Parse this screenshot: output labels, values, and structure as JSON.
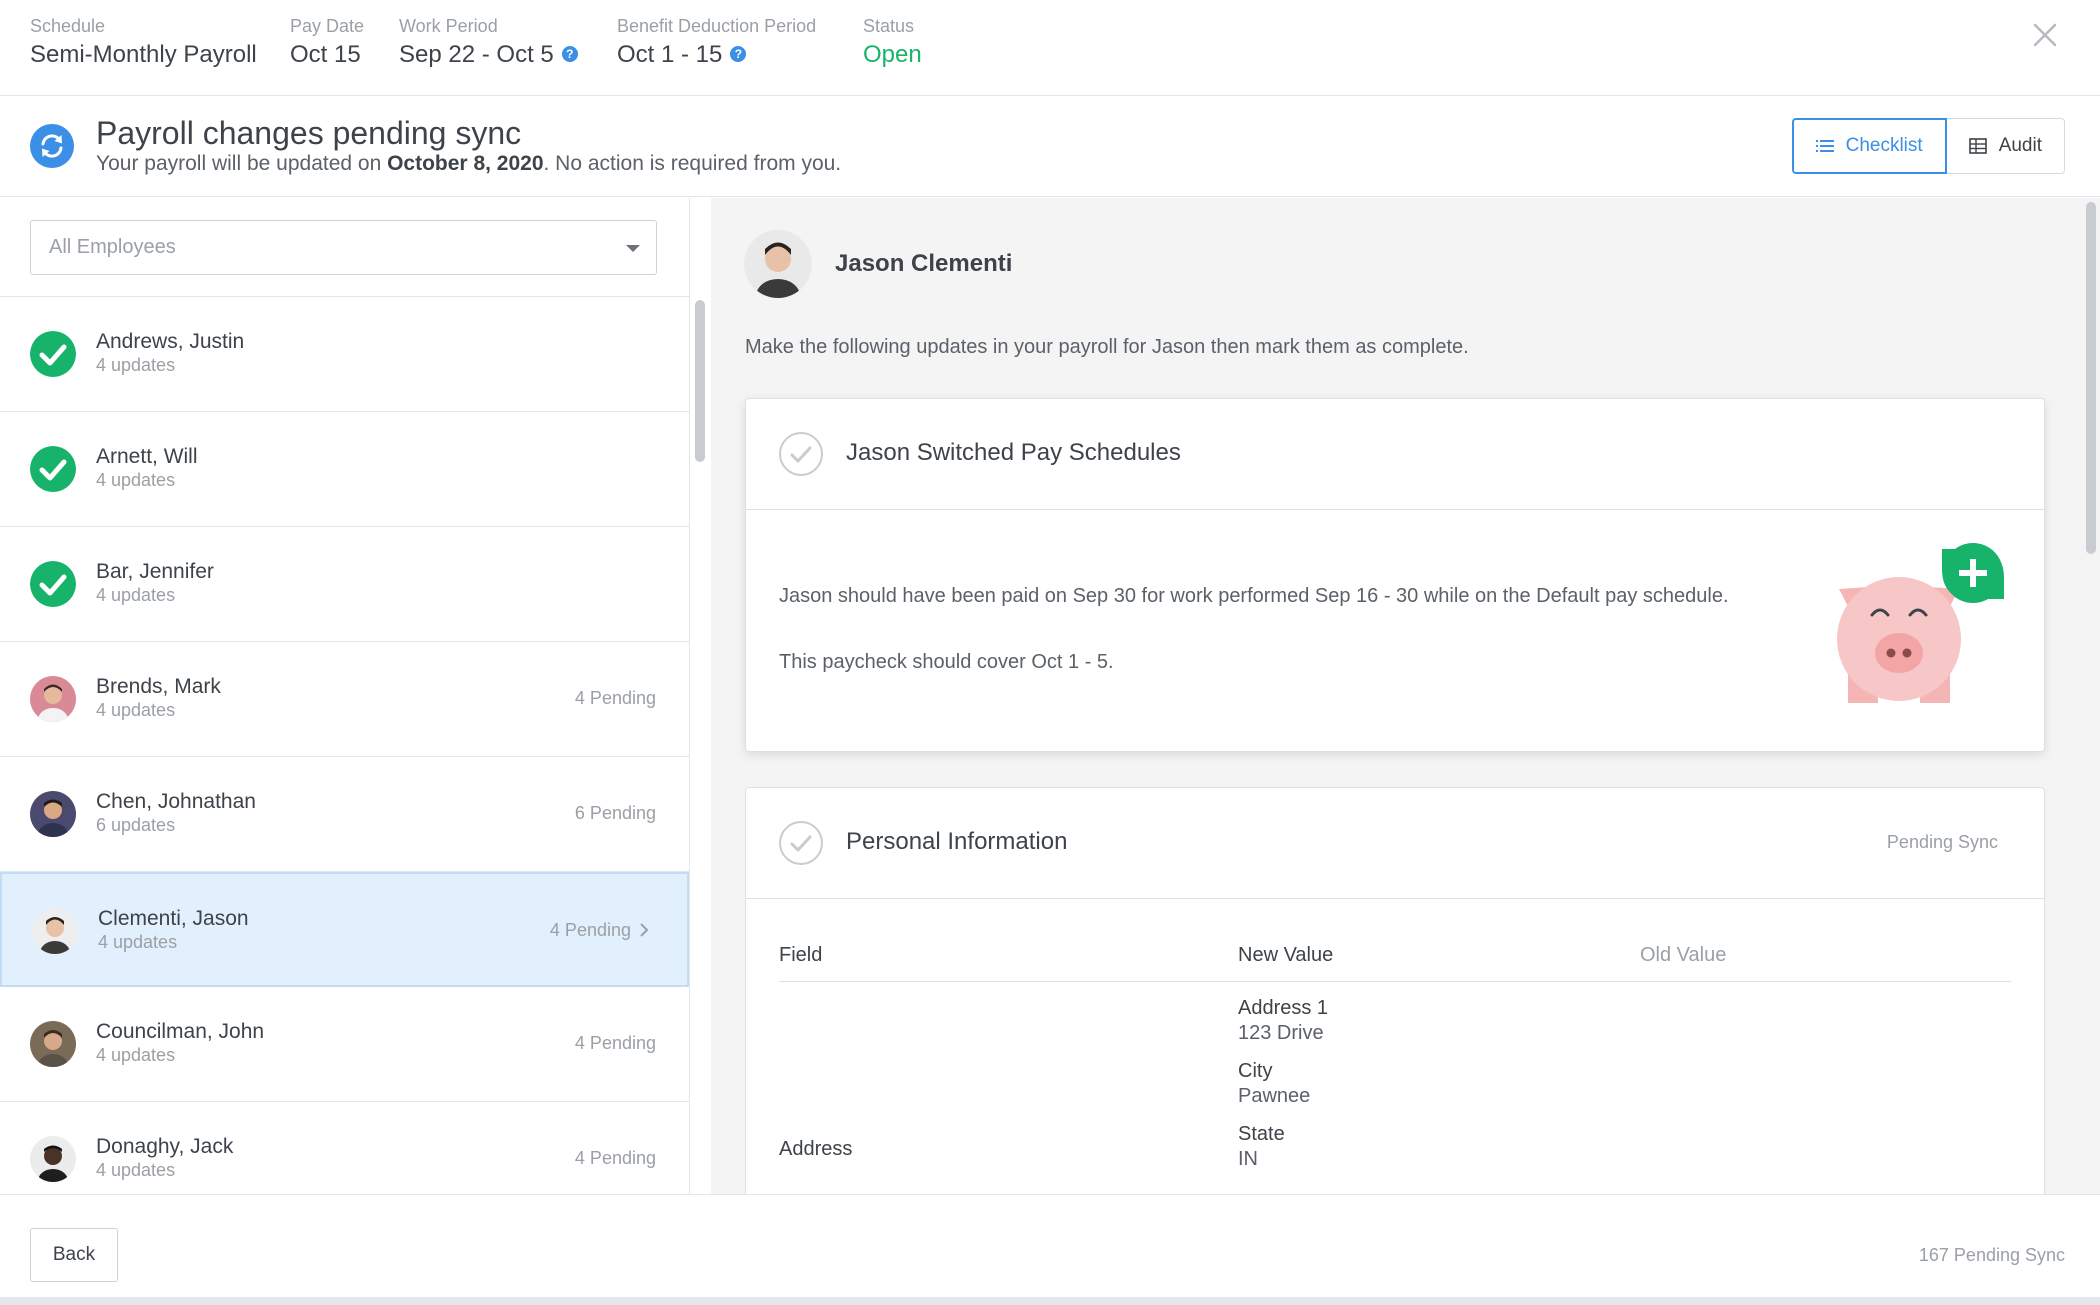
{
  "header": {
    "schedule": {
      "label": "Schedule",
      "value": "Semi-Monthly Payroll"
    },
    "pay_date": {
      "label": "Pay Date",
      "value": "Oct 15"
    },
    "work_period": {
      "label": "Work Period",
      "value": "Sep 22 - Oct 5"
    },
    "benefit_period": {
      "label": "Benefit Deduction Period",
      "value": "Oct 1 - 15"
    },
    "status": {
      "label": "Status",
      "value": "Open"
    },
    "help_glyph": "?"
  },
  "banner": {
    "title": "Payroll changes pending sync",
    "sub_prefix": "Your payroll will be updated on ",
    "sub_date": "October 8, 2020",
    "sub_suffix": ". No action is required from you.",
    "checklist_label": "Checklist",
    "audit_label": "Audit"
  },
  "filter": {
    "selected": "All Employees"
  },
  "employees": [
    {
      "name": "Andrews, Justin",
      "updates": "4 updates",
      "pending": "",
      "state": "complete"
    },
    {
      "name": "Arnett, Will",
      "updates": "4 updates",
      "pending": "",
      "state": "complete"
    },
    {
      "name": "Bar, Jennifer",
      "updates": "4 updates",
      "pending": "",
      "state": "complete"
    },
    {
      "name": "Brends, Mark",
      "updates": "4 updates",
      "pending": "4 Pending",
      "state": "pending"
    },
    {
      "name": "Chen, Johnathan",
      "updates": "6 updates",
      "pending": "6 Pending",
      "state": "pending"
    },
    {
      "name": "Clementi, Jason",
      "updates": "4 updates",
      "pending": "4 Pending",
      "state": "selected"
    },
    {
      "name": "Councilman, John",
      "updates": "4 updates",
      "pending": "4 Pending",
      "state": "pending"
    },
    {
      "name": "Donaghy, Jack",
      "updates": "4 updates",
      "pending": "4 Pending",
      "state": "pending"
    }
  ],
  "detail": {
    "name": "Jason Clementi",
    "intro": "Make the following updates in your payroll for Jason then mark them as complete.",
    "card1": {
      "title": "Jason Switched Pay Schedules",
      "p1": "Jason should have been paid on Sep 30 for work performed Sep 16 - 30 while on the Default pay schedule.",
      "p2": "This paycheck should cover Oct 1 - 5."
    },
    "card2": {
      "title": "Personal Information",
      "badge": "Pending Sync",
      "col_field": "Field",
      "col_new": "New Value",
      "col_old": "Old Value",
      "row_label": "Address",
      "entries": [
        {
          "key": "Address 1",
          "value": "123 Drive"
        },
        {
          "key": "City",
          "value": "Pawnee"
        },
        {
          "key": "State",
          "value": "IN"
        }
      ]
    }
  },
  "footer": {
    "back_label": "Back",
    "count": "167 Pending Sync"
  },
  "colors": {
    "accent": "#3b8fe6",
    "success": "#18b36b",
    "selected_row": "#e2effc"
  }
}
